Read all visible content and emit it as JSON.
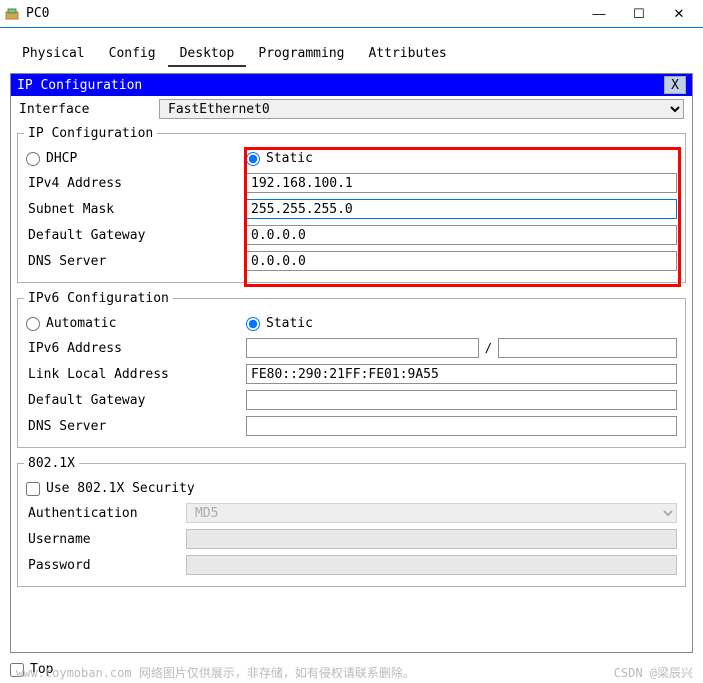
{
  "window": {
    "title": "PC0",
    "min": "—",
    "max": "☐",
    "close": "✕"
  },
  "tabs": {
    "physical": "Physical",
    "config": "Config",
    "desktop": "Desktop",
    "programming": "Programming",
    "attributes": "Attributes"
  },
  "subheader": {
    "title": "IP Configuration",
    "close": "X"
  },
  "interface": {
    "label": "Interface",
    "value": "FastEthernet0"
  },
  "ipconf": {
    "legend": "IP Configuration",
    "dhcp": "DHCP",
    "static": "Static",
    "ipv4_label": "IPv4 Address",
    "ipv4_value": "192.168.100.1",
    "subnet_label": "Subnet Mask",
    "subnet_value": "255.255.255.0",
    "gateway_label": "Default Gateway",
    "gateway_value": "0.0.0.0",
    "dns_label": "DNS Server",
    "dns_value": "0.0.0.0"
  },
  "ipv6conf": {
    "legend": "IPv6 Configuration",
    "automatic": "Automatic",
    "static": "Static",
    "ipv6_label": "IPv6 Address",
    "ipv6_value": "",
    "prefix_value": "",
    "linklocal_label": "Link Local Address",
    "linklocal_value": "FE80::290:21FF:FE01:9A55",
    "gateway_label": "Default Gateway",
    "gateway_value": "",
    "dns_label": "DNS Server",
    "dns_value": ""
  },
  "dot1x": {
    "legend": "802.1X",
    "use_label": "Use 802.1X Security",
    "auth_label": "Authentication",
    "auth_value": "MD5",
    "user_label": "Username",
    "user_value": "",
    "pass_label": "Password",
    "pass_value": ""
  },
  "footer": {
    "top": "Top"
  },
  "watermark": {
    "left": "www.toymoban.com  网络图片仅供展示，非存储，如有侵权请联系删除。",
    "right": "CSDN @梁辰兴"
  }
}
